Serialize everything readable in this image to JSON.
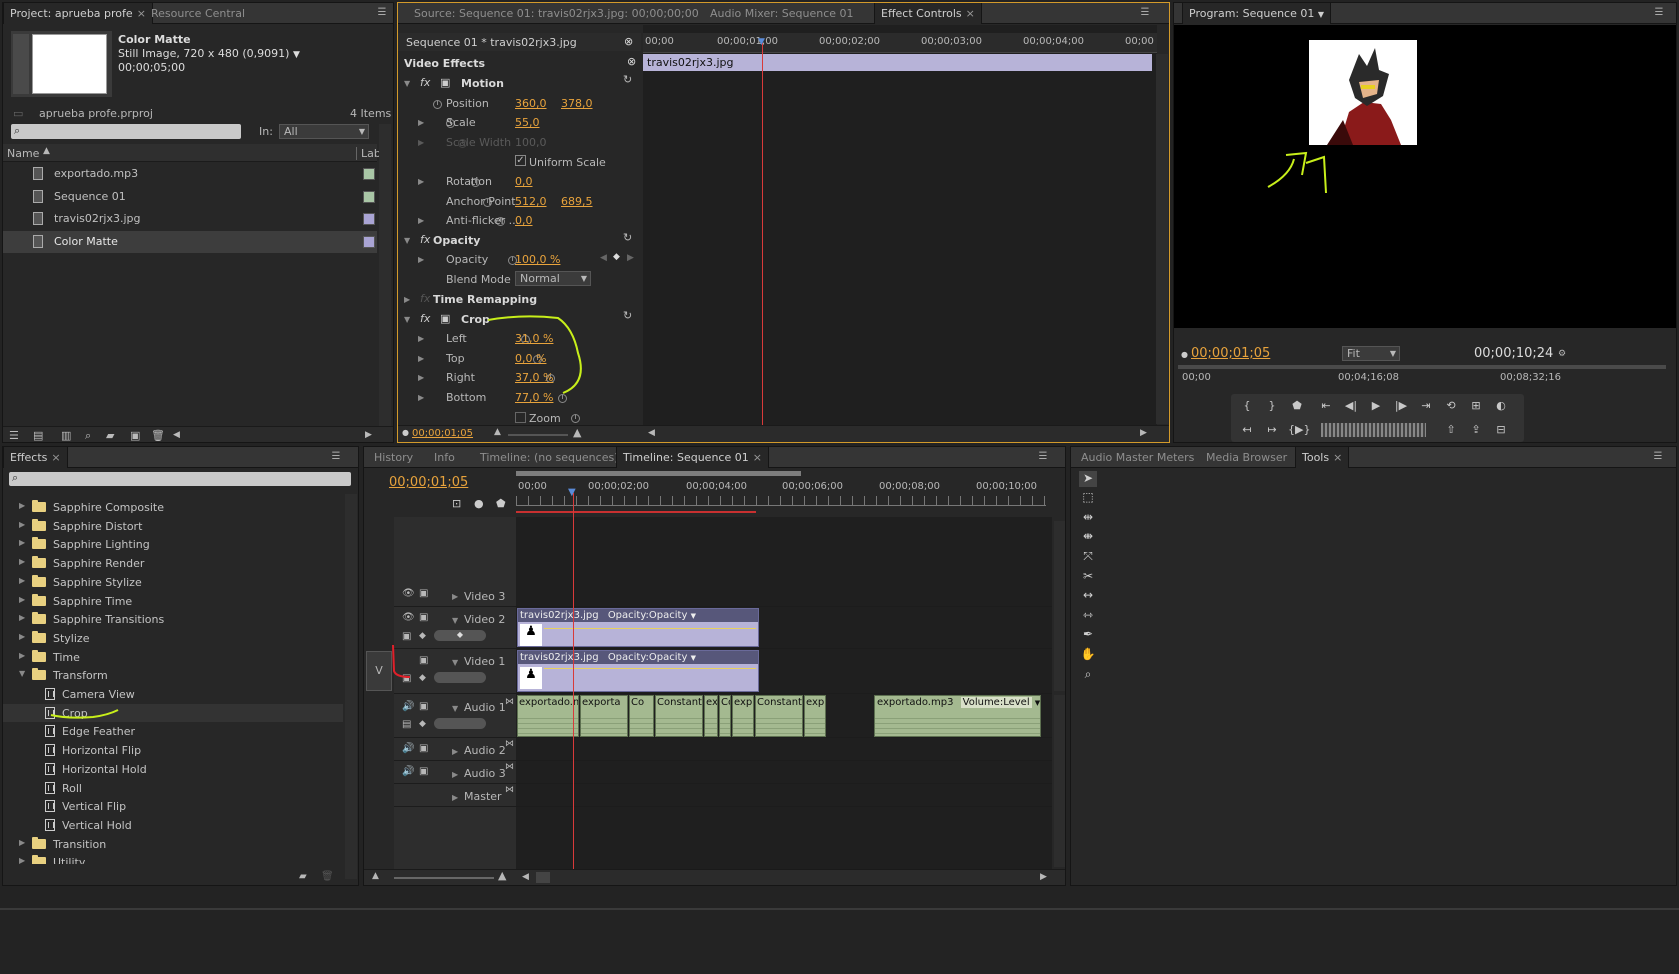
{
  "project": {
    "tabs": [
      "Project: aprueba profe",
      "Resource Central"
    ],
    "clip_name": "Color Matte",
    "clip_info1": "Still Image, 720 x 480 (0,9091)",
    "clip_info2": "00;00;05;00",
    "file_name": "aprueba profe.prproj",
    "item_count": "4 Items",
    "in_label": "In:",
    "in_value": "All",
    "col_name": "Name",
    "col_label": "Lab",
    "items": [
      {
        "name": "exportado.mp3",
        "color": "#a9c6a6",
        "icon": "audio-file-icon"
      },
      {
        "name": "Sequence 01",
        "color": "#a9c6a6",
        "icon": "sequence-icon"
      },
      {
        "name": "travis02rjx3.jpg",
        "color": "#a9a4d4",
        "icon": "image-file-icon"
      },
      {
        "name": "Color Matte",
        "color": "#a9a4d4",
        "icon": "image-file-icon"
      }
    ]
  },
  "effect_controls": {
    "tabs": [
      "Source: Sequence 01: travis02rjx3.jpg: 00;00;00;00",
      "Audio Mixer: Sequence 01",
      "Effect Controls"
    ],
    "clip_header": "Sequence 01 * travis02rjx3.jpg",
    "video_effects": "Video Effects",
    "motion": "Motion",
    "position_label": "Position",
    "position_x": "360,0",
    "position_y": "378,0",
    "scale_label": "Scale",
    "scale_value": "55,0",
    "scale_width_label": "Scale Width",
    "scale_width_value": "100,0",
    "uniform_scale": "Uniform Scale",
    "rotation_label": "Rotation",
    "rotation_value": "0,0",
    "anchor_label": "Anchor Point",
    "anchor_x": "512,0",
    "anchor_y": "689,5",
    "antiflicker_label": "Anti-flicker ...",
    "antiflicker_value": "0,0",
    "opacity_section": "Opacity",
    "opacity_label": "Opacity",
    "opacity_value": "100,0 %",
    "blend_label": "Blend Mode",
    "blend_value": "Normal",
    "time_remap": "Time Remapping",
    "crop": "Crop",
    "left_label": "Left",
    "left_value": "31,0 %",
    "top_label": "Top",
    "top_value": "0,0 %",
    "right_label": "Right",
    "right_value": "37,0 %",
    "bottom_label": "Bottom",
    "bottom_value": "77,0 %",
    "zoom_label": "Zoom",
    "timecode": "00;00;01;05",
    "ruler": [
      "00;00",
      "00;00;01;00",
      "00;00;02;00",
      "00;00;03;00",
      "00;00;04;00",
      "00;00"
    ],
    "clip_bar_label": "travis02rjx3.jpg"
  },
  "program": {
    "tab": "Program: Sequence 01",
    "timecode": "00;00;01;05",
    "fit": "Fit",
    "duration": "00;00;10;24",
    "ruler": [
      "00;00",
      "00;04;16;08",
      "00;08;32;16"
    ]
  },
  "effects_panel": {
    "tab": "Effects",
    "items": [
      {
        "label": "Sapphire Composite",
        "type": "folder",
        "indent": 0,
        "expanded": false
      },
      {
        "label": "Sapphire Distort",
        "type": "folder",
        "indent": 0,
        "expanded": false
      },
      {
        "label": "Sapphire Lighting",
        "type": "folder",
        "indent": 0,
        "expanded": false
      },
      {
        "label": "Sapphire Render",
        "type": "folder",
        "indent": 0,
        "expanded": false
      },
      {
        "label": "Sapphire Stylize",
        "type": "folder",
        "indent": 0,
        "expanded": false
      },
      {
        "label": "Sapphire Time",
        "type": "folder",
        "indent": 0,
        "expanded": false
      },
      {
        "label": "Sapphire Transitions",
        "type": "folder",
        "indent": 0,
        "expanded": false
      },
      {
        "label": "Stylize",
        "type": "folder",
        "indent": 0,
        "expanded": false
      },
      {
        "label": "Time",
        "type": "folder",
        "indent": 0,
        "expanded": false
      },
      {
        "label": "Transform",
        "type": "folder",
        "indent": 0,
        "expanded": true
      },
      {
        "label": "Camera View",
        "type": "effect",
        "indent": 1
      },
      {
        "label": "Crop",
        "type": "effect",
        "indent": 1
      },
      {
        "label": "Edge Feather",
        "type": "effect",
        "indent": 1
      },
      {
        "label": "Horizontal Flip",
        "type": "effect",
        "indent": 1
      },
      {
        "label": "Horizontal Hold",
        "type": "effect",
        "indent": 1
      },
      {
        "label": "Roll",
        "type": "effect",
        "indent": 1
      },
      {
        "label": "Vertical Flip",
        "type": "effect",
        "indent": 1
      },
      {
        "label": "Vertical Hold",
        "type": "effect",
        "indent": 1
      },
      {
        "label": "Transition",
        "type": "folder",
        "indent": 0,
        "expanded": false
      },
      {
        "label": "Utility",
        "type": "folder",
        "indent": 0,
        "expanded": false
      }
    ]
  },
  "timeline": {
    "tabs": [
      "History",
      "Info",
      "Timeline: (no sequences)",
      "Timeline: Sequence 01"
    ],
    "timecode": "00;00;01;05",
    "ruler": [
      "00;00",
      "00;00;02;00",
      "00;00;04;00",
      "00;00;06;00",
      "00;00;08;00",
      "00;00;10;00"
    ],
    "tracks": [
      "Video 3",
      "Video 2",
      "Video 1",
      "Audio 1",
      "Audio 2",
      "Audio 3",
      "Master"
    ],
    "target_label": "V",
    "video2_clip": "travis02rjx3.jpg",
    "video2_fx": "Opacity:Opacity",
    "video1_clip": "travis02rjx3.jpg",
    "video1_fx": "Opacity:Opacity",
    "audio_clips": [
      "exportado.m",
      "exporta",
      "Co",
      "Constant",
      "ex",
      "Co",
      "exp",
      "Constant",
      "exp"
    ],
    "audio_clip2": "exportado.mp3",
    "audio_clip2_fx": "Volume:Level"
  },
  "tools_panel": {
    "tabs": [
      "Audio Master Meters",
      "Media Browser",
      "Tools"
    ]
  }
}
